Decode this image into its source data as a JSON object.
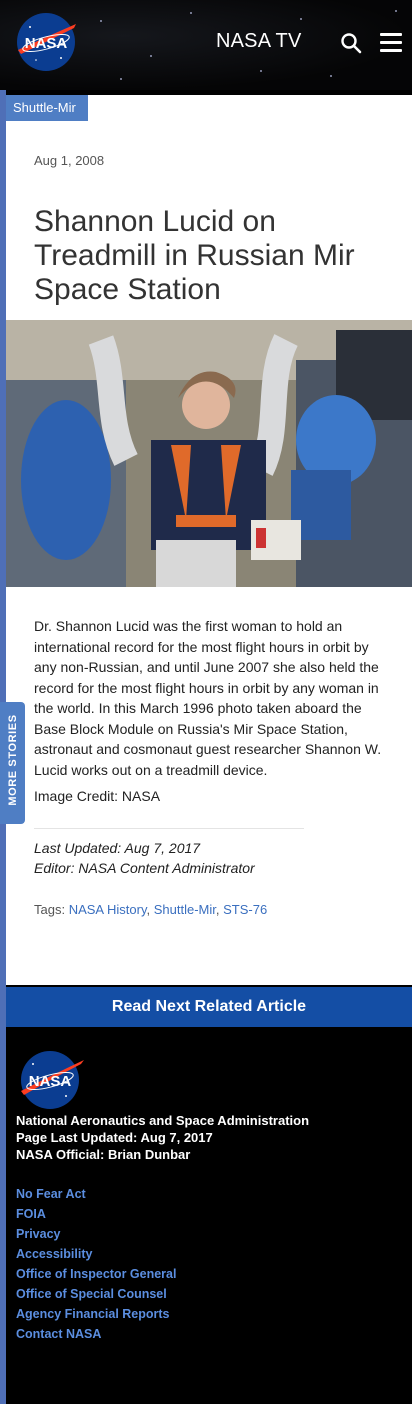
{
  "header": {
    "logo_text": "NASA",
    "nasa_tv": "NASA TV",
    "search_icon": "search-icon",
    "menu_icon": "hamburger-menu-icon"
  },
  "article": {
    "category": "Shuttle-Mir",
    "date": "Aug 1, 2008",
    "title": "Shannon Lucid on Treadmill in Russian Mir Space Station",
    "description": "Dr. Shannon Lucid was the first woman to hold an international record for the most flight hours in orbit by any non-Russian, and until June 2007 she also held the record for the most flight hours in orbit by any woman in the world. In this March 1996 photo taken aboard the Base Block Module on Russia's Mir Space Station, astronaut and cosmonaut guest researcher Shannon W. Lucid works out on a treadmill device.",
    "credit": "Image Credit: NASA",
    "last_updated": "Last Updated: Aug 7, 2017",
    "editor": "Editor: NASA Content Administrator",
    "tags_label": "Tags:",
    "tags": [
      "NASA History",
      "Shuttle-Mir",
      "STS-76"
    ],
    "tag_sep": ","
  },
  "more_stories": "MORE STORIES",
  "read_next": "Read Next Related Article",
  "footer": {
    "logo_text": "NASA",
    "agency": "National Aeronautics and Space Administration",
    "page_updated": "Page Last Updated: Aug 7, 2017",
    "official": "NASA Official: Brian Dunbar",
    "links": [
      "No Fear Act",
      "FOIA",
      "Privacy",
      "Accessibility",
      "Office of Inspector General",
      "Office of Special Counsel",
      "Agency Financial Reports",
      "Contact NASA"
    ]
  },
  "colors": {
    "accent_blue": "#4f7ec4",
    "read_next_bg": "#144ea5",
    "link_blue": "#5b8ee0",
    "nasa_blue": "#0b3d91",
    "nasa_red": "#fc3d21"
  }
}
